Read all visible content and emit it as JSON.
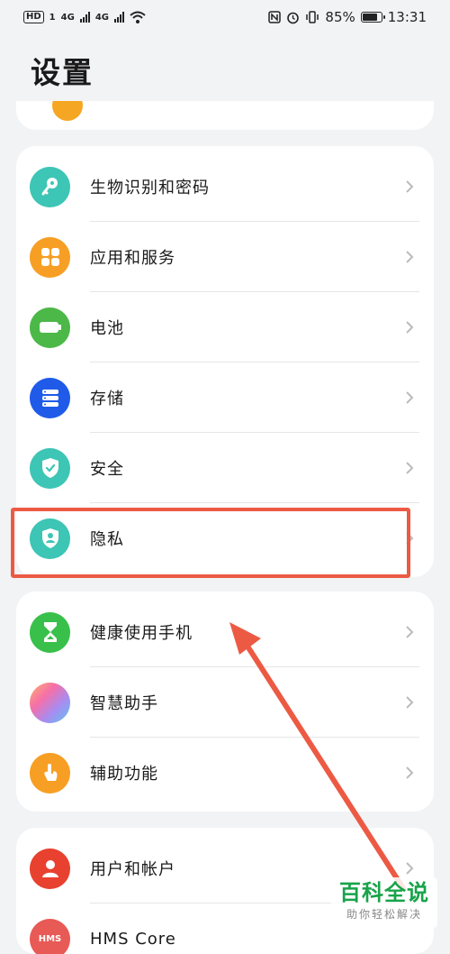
{
  "statusbar": {
    "left_badge": "HD",
    "sim1": "1",
    "net1": "4G",
    "net2": "4G",
    "battery_percent_text": "85%",
    "battery_level": 0.85,
    "time": "13:31"
  },
  "page": {
    "title": "设置"
  },
  "groups": [
    {
      "items": [
        {
          "label": "生物识别和密码",
          "icon": "key-icon",
          "color": "#3dc5b5"
        },
        {
          "label": "应用和服务",
          "icon": "apps-grid-icon",
          "color": "#f79f24"
        },
        {
          "label": "电池",
          "icon": "battery-icon",
          "color": "#4cb848"
        },
        {
          "label": "存储",
          "icon": "storage-icon",
          "color": "#1f5be8"
        },
        {
          "label": "安全",
          "icon": "shield-check-icon",
          "color": "#3dc5b5"
        },
        {
          "label": "隐私",
          "icon": "privacy-shield-icon",
          "color": "#3dc5b5"
        }
      ]
    },
    {
      "items": [
        {
          "label": "健康使用手机",
          "icon": "hourglass-icon",
          "color": "#39c04a"
        },
        {
          "label": "智慧助手",
          "icon": "assistant-orb-icon",
          "color": "#a88cf0"
        },
        {
          "label": "辅助功能",
          "icon": "hand-pointer-icon",
          "color": "#f79f24"
        }
      ]
    },
    {
      "items": [
        {
          "label": "用户和帐户",
          "icon": "user-icon",
          "color": "#e8412f"
        },
        {
          "label": "HMS Core",
          "icon": "hms-core-icon",
          "icon_text": "HMS",
          "color": "#e85a56"
        }
      ]
    }
  ],
  "annotation": {
    "highlight_color": "#ec5a44",
    "highlighted_item": "隐私"
  },
  "watermark": {
    "main": "百科全说",
    "sub": "助你轻松解决"
  }
}
